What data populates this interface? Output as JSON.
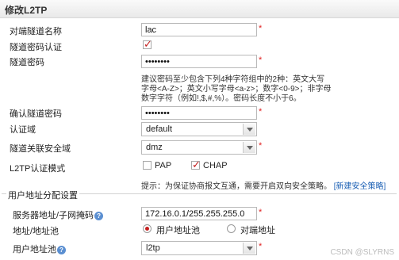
{
  "title": "修改L2TP",
  "fields": {
    "tunnel_name_label": "对端隧道名称",
    "tunnel_name_value": "lac",
    "tunnel_auth_label": "隧道密码认证",
    "tunnel_pwd_label": "隧道密码",
    "tunnel_pwd_value": "••••••••",
    "password_hint": "建议密码至少包含下列4种字符组中的2种：英文大写字母<A-Z>；英文小写字母<a-z>；数字<0-9>；非字母数字字符（例如!,$,#,%）。密码长度不小于6。",
    "confirm_pwd_label": "确认隧道密码",
    "confirm_pwd_value": "••••••••",
    "auth_domain_label": "认证域",
    "auth_domain_value": "default",
    "security_zone_label": "隧道关联安全域",
    "security_zone_value": "dmz",
    "auth_mode_label": "L2TP认证模式",
    "pap_label": "PAP",
    "chap_label": "CHAP",
    "policy_hint": "提示：为保证协商报文互通，需要开启双向安全策略。",
    "policy_link": "[新建安全策略]"
  },
  "address": {
    "legend": "用户地址分配设置",
    "server_addr_label": "服务器地址/子网掩码",
    "server_addr_value": "172.16.0.1/255.255.255.0",
    "addr_pool_label": "地址/地址池",
    "user_pool_option": "用户地址池",
    "peer_addr_option": "对端地址",
    "user_pool_label": "用户地址池",
    "user_pool_value": "l2tp"
  },
  "required_mark": "*",
  "help_mark": "?",
  "watermark": "CSDN @SLYRNS"
}
